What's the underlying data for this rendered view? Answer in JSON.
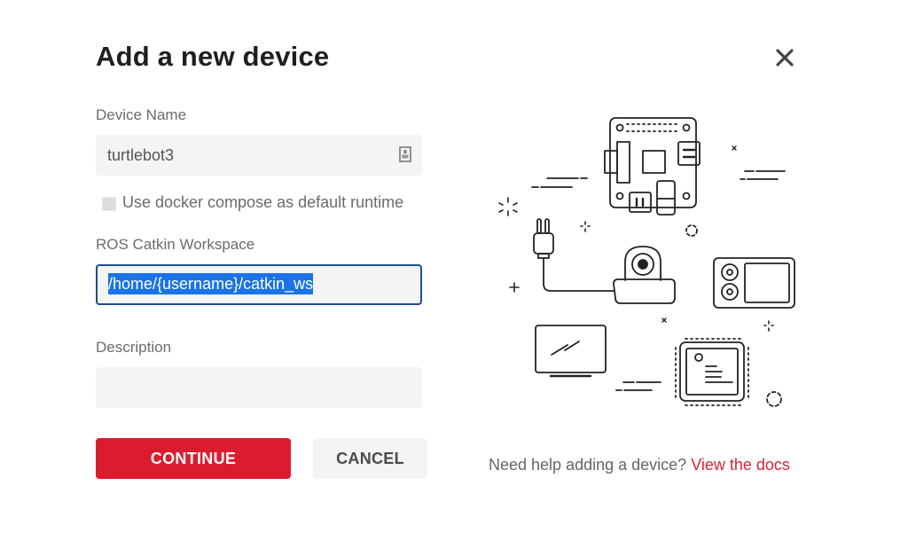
{
  "dialog": {
    "title": "Add a new device",
    "close_icon": "close-icon"
  },
  "form": {
    "device_name": {
      "label": "Device Name",
      "value": "turtlebot3",
      "icon": "contact-card-icon"
    },
    "docker_compose": {
      "label": "Use docker compose as default runtime",
      "checked": false
    },
    "workspace": {
      "label": "ROS Catkin Workspace",
      "value": "/home/{username}/catkin_ws",
      "selected": true
    },
    "description": {
      "label": "Description",
      "value": ""
    }
  },
  "buttons": {
    "continue_label": "CONTINUE",
    "cancel_label": "CANCEL"
  },
  "help": {
    "text": "Need help adding a device?",
    "link_text": "View the docs"
  },
  "colors": {
    "primary": "#dc1c2e",
    "link": "#d3263a",
    "focus_border": "#1f4e8c",
    "selection": "#1a73e8"
  }
}
